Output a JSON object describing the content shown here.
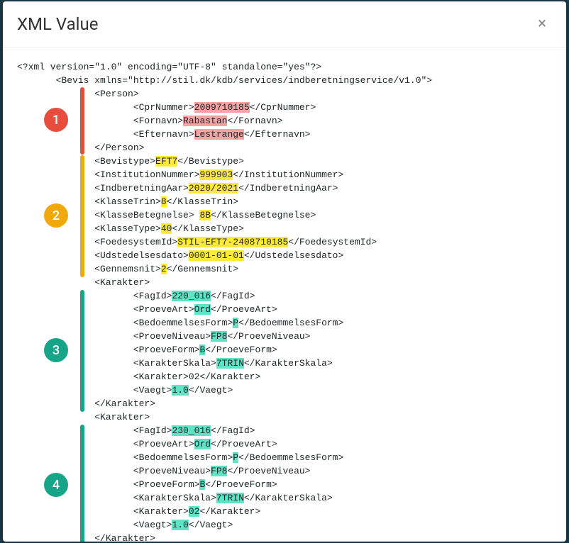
{
  "modal": {
    "title": "XML Value",
    "close_symbol": "×"
  },
  "badges": {
    "b1": "1",
    "b2": "2",
    "b3": "3",
    "b4": "4"
  },
  "xml": {
    "decl": "<?xml version=\"1.0\" encoding=\"UTF-8\" standalone=\"yes\"?>",
    "bevis_open": "       <Bevis xmlns=\"http://stil.dk/kdb/services/indberetningservice/v1.0\">",
    "person_open": "              <Person>",
    "cpr": {
      "pre": "                     <CprNummer>",
      "val": "2009710185",
      "post": "</CprNummer>"
    },
    "fornavn": {
      "pre": "                     <Fornavn>",
      "val": "Rabastan",
      "post": "</Fornavn>"
    },
    "efternavn": {
      "pre": "                     <Efternavn>",
      "val": "Lestrange",
      "post": "</Efternavn>"
    },
    "person_close": "              </Person>",
    "bevistype": {
      "pre": "              <Bevistype>",
      "val": "EFT7",
      "post": "</Bevistype>"
    },
    "instnr": {
      "pre": "              <InstitutionNummer>",
      "val": "999903",
      "post": "</InstitutionNummer>"
    },
    "indberet": {
      "pre": "              <IndberetningAar>",
      "val": "2020/2021",
      "post": "</IndberetningAar>"
    },
    "klassetrin": {
      "pre": "              <KlasseTrin>",
      "val": "8",
      "post": "</KlasseTrin>"
    },
    "klassebet": {
      "pre": "              <KlasseBetegnelse> ",
      "val": "8B",
      "post": "</KlasseBetegnelse>"
    },
    "klassetype": {
      "pre": "              <KlasseType>",
      "val": "40",
      "post": "</KlasseType>"
    },
    "foedesys": {
      "pre": "              <FoedesystemId>",
      "val": "STIL-EFT7-2408710185",
      "post": "</FoedesystemId>"
    },
    "udsted": {
      "pre": "              <Udstedelsesdato>",
      "val": "0001-01-01",
      "post": "</Udstedelsesdato>"
    },
    "gennemsnit": {
      "pre": "              <Gennemsnit>",
      "val": "2",
      "post": "</Gennemsnit>"
    },
    "kar_open": "              <Karakter>",
    "kar_close": "              </Karakter>",
    "k1": {
      "fagid": {
        "pre": "                     <FagId>",
        "val": "220_016",
        "post": "</FagId>"
      },
      "proeveart": {
        "pre": "                     <ProeveArt>",
        "val": "Ord",
        "post": "</ProeveArt>"
      },
      "bedform": {
        "pre": "                     <BedoemmelsesForm>",
        "val": "P",
        "post": "</BedoemmelsesForm>"
      },
      "proeveniv": {
        "pre": "                     <ProeveNiveau>",
        "val": "FP8",
        "post": "</ProeveNiveau>"
      },
      "proeveform": {
        "pre": "                     <ProeveForm>",
        "val": "B",
        "post": "</ProeveForm>"
      },
      "skala": {
        "pre": "                     <KarakterSkala>",
        "val": "7TRIN",
        "post": "</KarakterSkala>"
      },
      "karakter": {
        "pre": "                     <Karakter>",
        "val": "02",
        "post": "</Karakter>"
      },
      "vaegt": {
        "pre": "                     <Vaegt>",
        "val": "1.0",
        "post": "</Vaegt>"
      }
    },
    "k2": {
      "fagid": {
        "pre": "                     <FagId>",
        "val": "230_016",
        "post": "</FagId>"
      },
      "proeveart": {
        "pre": "                     <ProeveArt>",
        "val": "Ord",
        "post": "</ProeveArt>"
      },
      "bedform": {
        "pre": "                     <BedoemmelsesForm>",
        "val": "P",
        "post": "</BedoemmelsesForm>"
      },
      "proeveniv": {
        "pre": "                     <ProeveNiveau>",
        "val": "FP8",
        "post": "</ProeveNiveau>"
      },
      "proeveform": {
        "pre": "                     <ProeveForm>",
        "val": "B",
        "post": "</ProeveForm>"
      },
      "skala": {
        "pre": "                     <KarakterSkala>",
        "val": "7TRIN",
        "post": "</KarakterSkala>"
      },
      "karakter": {
        "pre": "                     <Karakter>",
        "val": "02",
        "post": "</Karakter>"
      },
      "vaegt": {
        "pre": "                     <Vaegt>",
        "val": "1.0",
        "post": "</Vaegt>"
      }
    }
  }
}
